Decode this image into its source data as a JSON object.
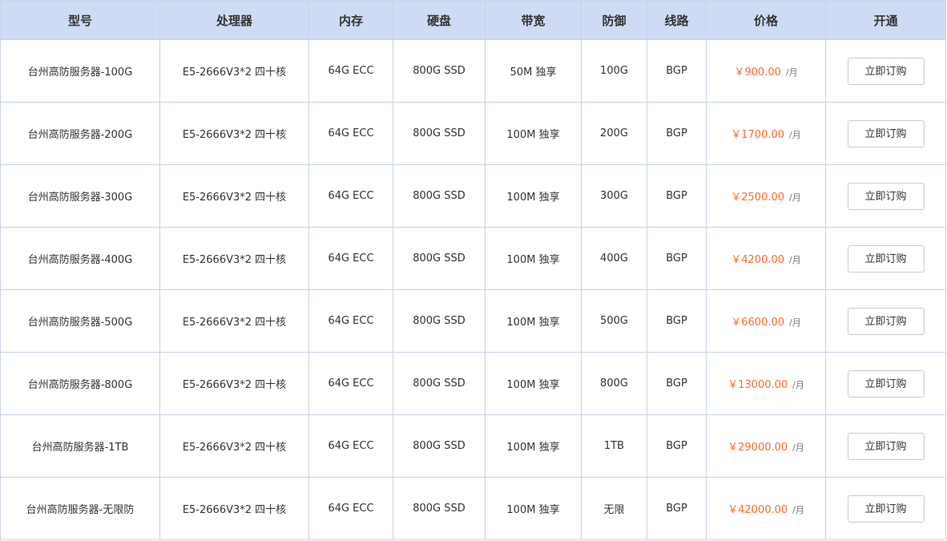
{
  "table": {
    "headers": [
      "型号",
      "处理器",
      "内存",
      "硬盘",
      "带宽",
      "防御",
      "线路",
      "价格",
      "开通"
    ],
    "rows": [
      {
        "model": "台州高防服务器-100G",
        "cpu": "E5-2666V3*2 四十核",
        "memory": "64G ECC",
        "disk": "800G SSD",
        "bandwidth": "50M 独享",
        "defense": "100G",
        "line": "BGP",
        "price": "￥900.00",
        "unit": "/月",
        "action": "立即订购"
      },
      {
        "model": "台州高防服务器-200G",
        "cpu": "E5-2666V3*2 四十核",
        "memory": "64G ECC",
        "disk": "800G SSD",
        "bandwidth": "100M 独享",
        "defense": "200G",
        "line": "BGP",
        "price": "￥1700.00",
        "unit": "/月",
        "action": "立即订购"
      },
      {
        "model": "台州高防服务器-300G",
        "cpu": "E5-2666V3*2 四十核",
        "memory": "64G ECC",
        "disk": "800G SSD",
        "bandwidth": "100M 独享",
        "defense": "300G",
        "line": "BGP",
        "price": "￥2500.00",
        "unit": "/月",
        "action": "立即订购"
      },
      {
        "model": "台州高防服务器-400G",
        "cpu": "E5-2666V3*2 四十核",
        "memory": "64G ECC",
        "disk": "800G SSD",
        "bandwidth": "100M 独享",
        "defense": "400G",
        "line": "BGP",
        "price": "￥4200.00",
        "unit": "/月",
        "action": "立即订购"
      },
      {
        "model": "台州高防服务器-500G",
        "cpu": "E5-2666V3*2 四十核",
        "memory": "64G ECC",
        "disk": "800G SSD",
        "bandwidth": "100M 独享",
        "defense": "500G",
        "line": "BGP",
        "price": "￥6600.00",
        "unit": "/月",
        "action": "立即订购"
      },
      {
        "model": "台州高防服务器-800G",
        "cpu": "E5-2666V3*2 四十核",
        "memory": "64G ECC",
        "disk": "800G SSD",
        "bandwidth": "100M 独享",
        "defense": "800G",
        "line": "BGP",
        "price": "￥13000.00",
        "unit": "/月",
        "action": "立即订购"
      },
      {
        "model": "台州高防服务器-1TB",
        "cpu": "E5-2666V3*2 四十核",
        "memory": "64G ECC",
        "disk": "800G SSD",
        "bandwidth": "100M 独享",
        "defense": "1TB",
        "line": "BGP",
        "price": "￥29000.00",
        "unit": "/月",
        "action": "立即订购"
      },
      {
        "model": "台州高防服务器-无限防",
        "cpu": "E5-2666V3*2 四十核",
        "memory": "64G ECC",
        "disk": "800G SSD",
        "bandwidth": "100M 独享",
        "defense": "无限",
        "line": "BGP",
        "price": "￥42000.00",
        "unit": "/月",
        "action": "立即订购"
      }
    ]
  },
  "colors": {
    "header_bg": "#cfdbf4",
    "border": "#c7d3e6",
    "price": "#ff6a2a",
    "text": "#333333"
  }
}
